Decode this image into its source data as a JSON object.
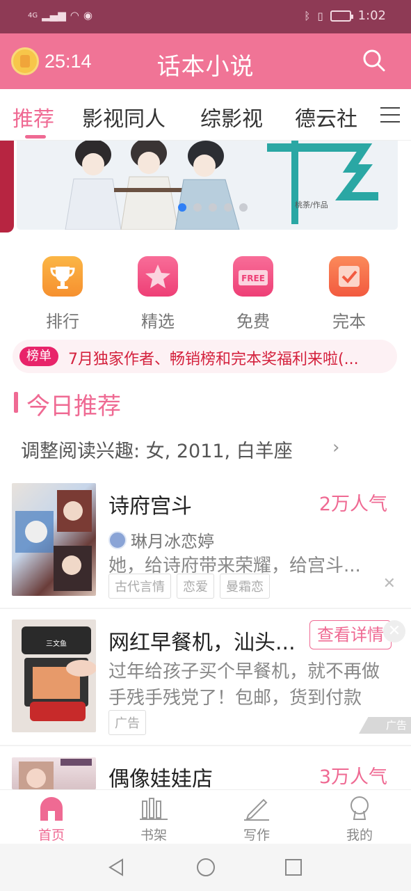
{
  "status_bar": {
    "signal": "4G",
    "time": "1:02"
  },
  "app_bar": {
    "timer": "25:14",
    "title": "话本小说"
  },
  "tabs": [
    {
      "label": "推荐",
      "active": true
    },
    {
      "label": "影视同人"
    },
    {
      "label": "综影视"
    },
    {
      "label": "德云社"
    }
  ],
  "banner": {
    "caption": "桃荼/作品",
    "page_count": 5,
    "active_index": 1
  },
  "quick_entries": [
    {
      "label": "排行",
      "icon": "trophy-icon",
      "color": "#f9a13a"
    },
    {
      "label": "精选",
      "icon": "star-icon",
      "color": "#f3558a"
    },
    {
      "label": "免费",
      "icon": "free-icon",
      "color": "#f3558a",
      "badge": "FREE"
    },
    {
      "label": "完本",
      "icon": "check-icon",
      "color": "#f56a4a"
    }
  ],
  "notice": {
    "tag": "榜单",
    "text": "7月独家作者、畅销榜和完本奖福利来啦(..."
  },
  "section": {
    "title": "今日推荐",
    "preference": "调整阅读兴趣: 女, 2011, 白羊座"
  },
  "books": [
    {
      "title": "诗府宫斗",
      "popularity": "2万人气",
      "author": "琳月冰恋婷",
      "description": "她，给诗府带来荣耀，给宫斗...",
      "tags": [
        "古代言情",
        "恋爱",
        "曼霜恋"
      ]
    },
    {
      "title": "网红早餐机，汕头...",
      "detail_button": "查看详情",
      "description_lines": [
        "过年给孩子买个早餐机，就不再做",
        "手残手残党了！包邮，货到付款"
      ],
      "tags": [
        "广告"
      ],
      "ad_label": "广告",
      "cover_text": "三文鱼"
    },
    {
      "title": "偶像娃娃店",
      "popularity": "3万人气"
    }
  ],
  "bottom_nav": [
    {
      "label": "首页",
      "active": true
    },
    {
      "label": "书架"
    },
    {
      "label": "写作"
    },
    {
      "label": "我的"
    }
  ],
  "colors": {
    "accent": "#ef6a93",
    "header": "#f07496",
    "status_bar": "#8e3a55"
  }
}
